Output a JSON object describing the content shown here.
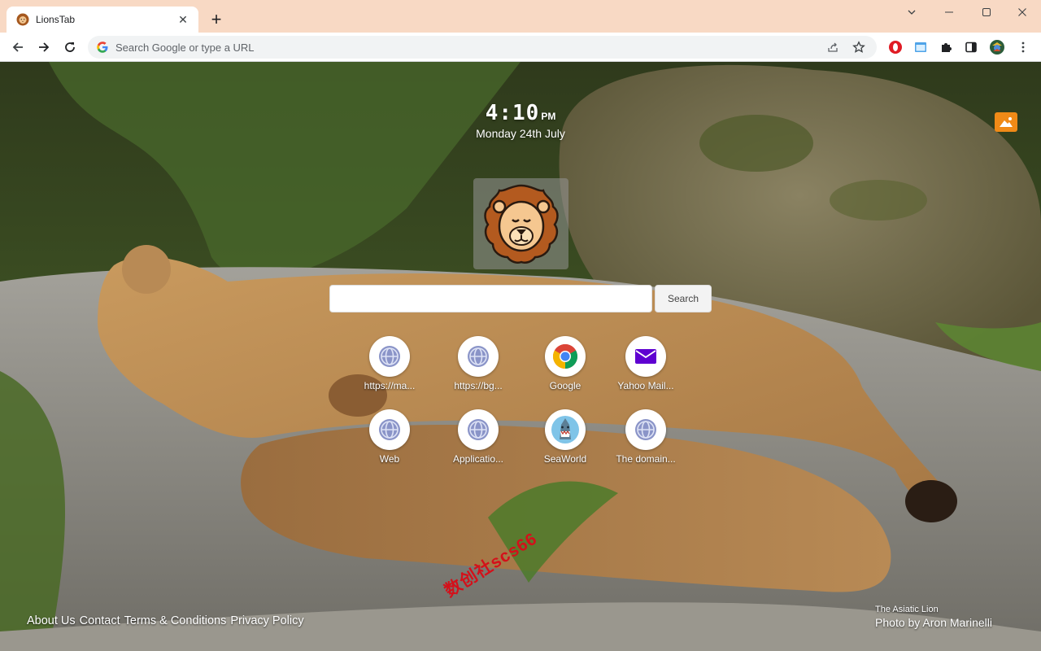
{
  "browser": {
    "tab_title": "LionsTab",
    "omnibox_placeholder": "Search Google or type a URL"
  },
  "clock": {
    "time": "4:10",
    "ampm": "PM",
    "date": "Monday 24th July"
  },
  "search": {
    "button_label": "Search",
    "placeholder": ""
  },
  "tiles": [
    {
      "label": "https://ma...",
      "icon": "globe-icon"
    },
    {
      "label": "https://bg...",
      "icon": "globe-icon"
    },
    {
      "label": "Google",
      "icon": "chrome-icon"
    },
    {
      "label": "Yahoo Mail...",
      "icon": "mail-icon"
    },
    {
      "label": "Web",
      "icon": "globe-icon"
    },
    {
      "label": "Applicatio...",
      "icon": "globe-icon"
    },
    {
      "label": "SeaWorld",
      "icon": "shark-icon"
    },
    {
      "label": "The domain...",
      "icon": "globe-icon"
    }
  ],
  "footer": {
    "links": [
      "About Us",
      "Contact",
      "Terms & Conditions",
      "Privacy Policy"
    ]
  },
  "photo": {
    "title": "The Asiatic Lion",
    "credit": "Photo by Aron Marinelli"
  },
  "watermark": "数创社scs66",
  "colors": {
    "titlebar": "#f8d9c4",
    "accent_orange": "#f08a17",
    "watermark_red": "#d4101a"
  }
}
